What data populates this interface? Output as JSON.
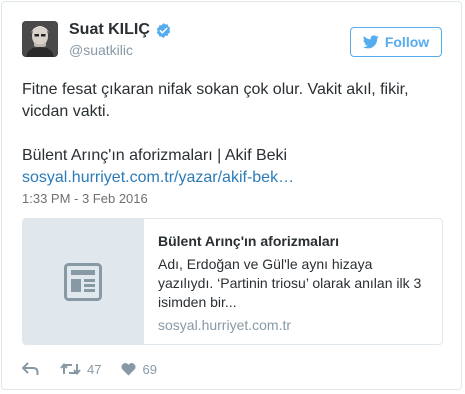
{
  "author": {
    "name": "Suat KILIÇ",
    "handle": "@suatkilic",
    "verified": true
  },
  "follow": {
    "label": "Follow"
  },
  "tweet": {
    "line1": "Fitne fesat çıkaran nifak sokan çok olur. Vakit akıl, fikir, vicdan vakti.",
    "line2": "Bülent Arınç'ın aforizmaları | Akif Beki",
    "link": "sosyal.hurriyet.com.tr/yazar/akif-bek…"
  },
  "timestamp": "1:33 PM - 3 Feb 2016",
  "card": {
    "title": "Bülent Arınç'ın aforizmaları",
    "description": "Adı, Erdoğan ve Gül'le aynı hizaya yazılıydı. ‘Partinin triosu’ olarak anılan ilk 3 isimden bir...",
    "domain": "sosyal.hurriyet.com.tr",
    "thumb_icon": "document-icon"
  },
  "actions": {
    "retweets": "47",
    "likes": "69"
  },
  "colors": {
    "accent": "#55acee",
    "link": "#2b7bb9",
    "muted": "#8899a6",
    "border": "#e1e8ed"
  }
}
